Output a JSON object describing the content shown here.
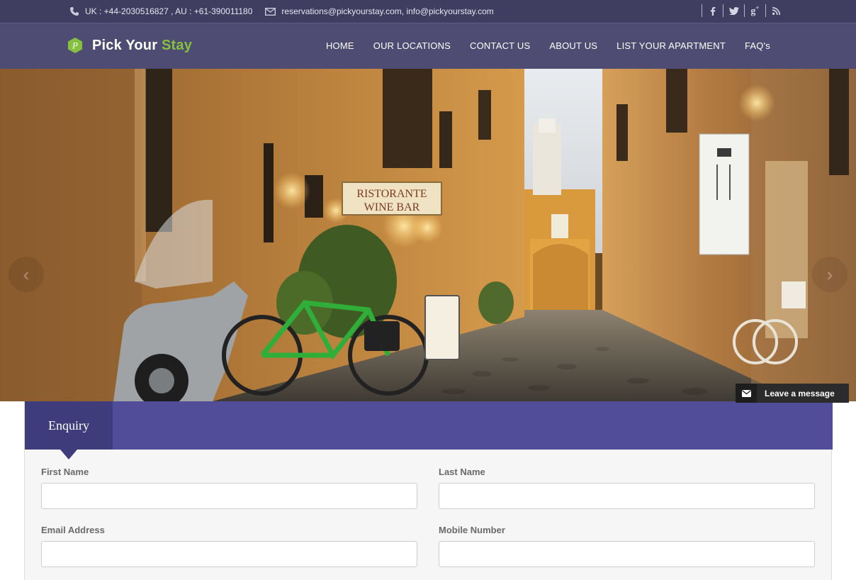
{
  "topbar": {
    "phone": "UK : +44-2030516827 , AU : +61-390011180",
    "email": "reservations@pickyourstay.com, info@pickyourstay.com",
    "social": [
      {
        "name": "facebook-icon",
        "glyph": "f"
      },
      {
        "name": "twitter-icon",
        "glyph": "t"
      },
      {
        "name": "google-plus-icon",
        "glyph": "g+"
      },
      {
        "name": "rss-icon",
        "glyph": "rss"
      }
    ]
  },
  "brand": {
    "name_part1": "Pick Your",
    "name_part2": "Stay",
    "logo_letter": "P",
    "accent_color": "#86c03f"
  },
  "nav": {
    "items": [
      "HOME",
      "OUR LOCATIONS",
      "CONTACT US",
      "ABOUT US",
      "LIST YOUR APARTMENT",
      "FAQ's"
    ]
  },
  "hero": {
    "sign_line1": "RISTORANTE",
    "sign_line2": "WINE BAR",
    "prev_glyph": "‹",
    "next_glyph": "›"
  },
  "chat": {
    "label": "Leave a message"
  },
  "enquiry": {
    "title": "Enquiry",
    "fields": {
      "first_name": {
        "label": "First Name",
        "value": ""
      },
      "last_name": {
        "label": "Last Name",
        "value": ""
      },
      "email": {
        "label": "Email Address",
        "value": ""
      },
      "mobile": {
        "label": "Mobile Number",
        "value": ""
      }
    }
  },
  "colors": {
    "topbar": "#3f3d60",
    "header": "#4e4c73",
    "enquiry_band": "#514d99",
    "enquiry_tab": "#3f3c7b"
  }
}
